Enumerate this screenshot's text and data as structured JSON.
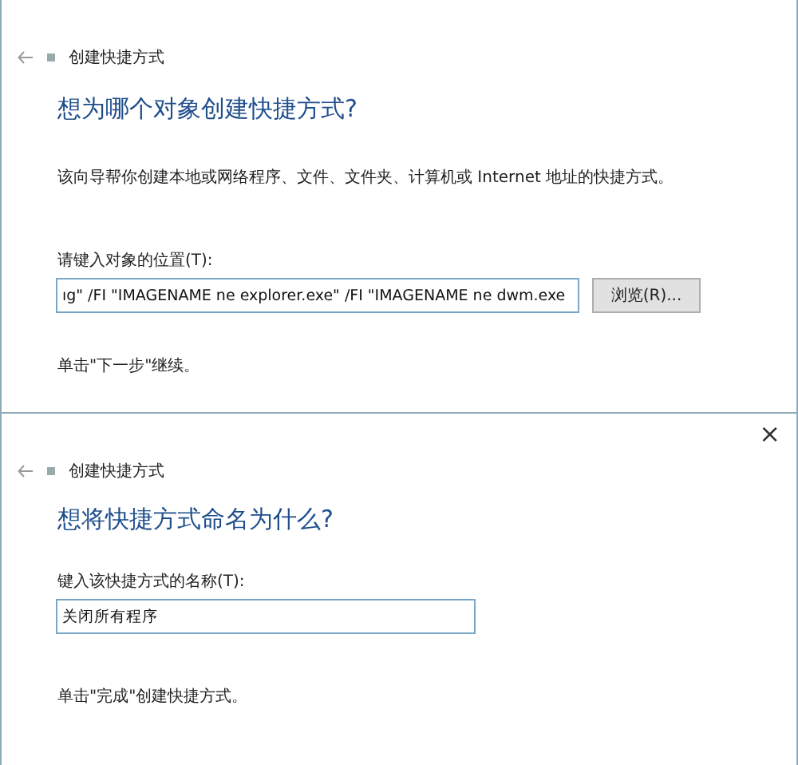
{
  "dialogs": [
    {
      "title": "创建快捷方式",
      "heading": "想为哪个对象创建快捷方式?",
      "description": "该向导帮你创建本地或网络程序、文件、文件夹、计算机或 Internet 地址的快捷方式。",
      "field_label": "请键入对象的位置(T):",
      "field_value": "ıg\" /FI \"IMAGENAME ne explorer.exe\" /FI \"IMAGENAME ne dwm.exe",
      "browse_button": "浏览(R)...",
      "footer": "单击\"下一步\"继续。"
    },
    {
      "title": "创建快捷方式",
      "close": "×",
      "heading": "想将快捷方式命名为什么?",
      "field_label": "键入该快捷方式的名称(T):",
      "field_value": "关闭所有程序",
      "footer": "单击\"完成\"创建快捷方式。"
    }
  ]
}
